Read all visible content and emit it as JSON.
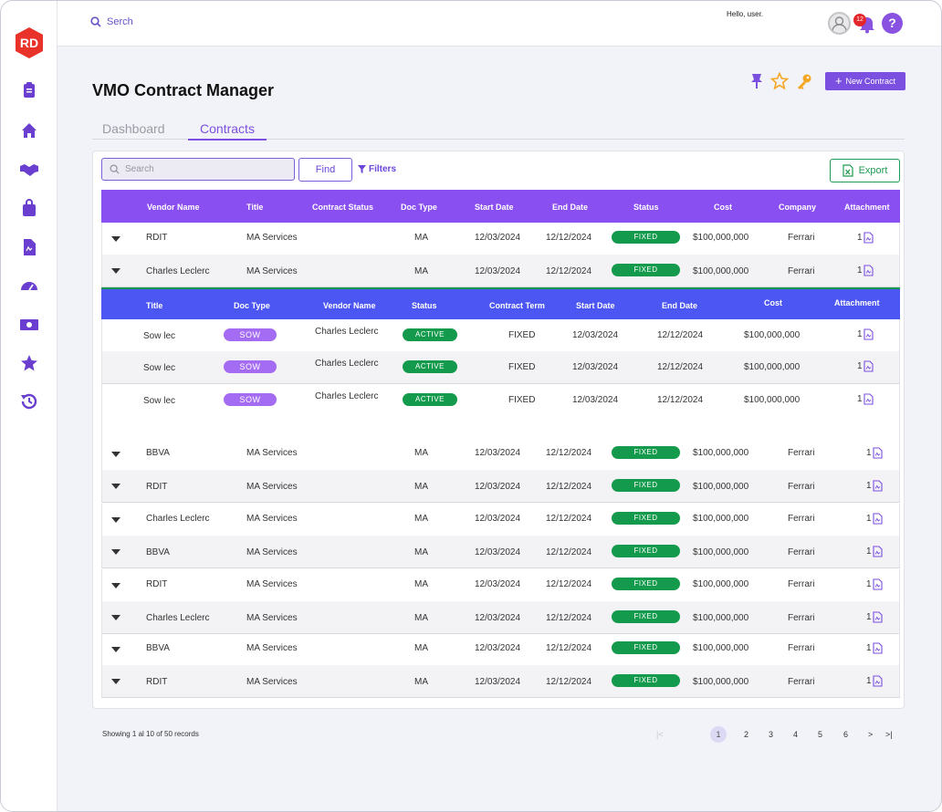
{
  "topbar": {
    "search_label": "Serch",
    "greeting": "Hello, user.",
    "notif_count": "12",
    "help_label": "?"
  },
  "page": {
    "title": "VMO Contract Manager",
    "new_contract_label": "New Contract"
  },
  "tabs": [
    {
      "label": "Dashboard"
    },
    {
      "label": "Contracts"
    }
  ],
  "toolbar": {
    "search_placeholder": "Search",
    "find_label": "Find",
    "filters_label": "Filters",
    "export_label": "Export"
  },
  "columns": [
    "Vendor Name",
    "Title",
    "Contract Status",
    "Doc Type",
    "Start Date",
    "End Date",
    "Status",
    "Cost",
    "Company",
    "Attachment"
  ],
  "sub_columns": [
    "Title",
    "Doc Type",
    "Vendor Name",
    "Status",
    "Contract Term",
    "Start Date",
    "End Date",
    "Cost",
    "Attachment"
  ],
  "rows": [
    {
      "vendor": "RDIT",
      "title": "MA Services",
      "doc": "MA",
      "start": "12/03/2024",
      "end": "12/12/2024",
      "status": "FIXED",
      "cost": "$100,000,000",
      "company": "Ferrari",
      "att": "1"
    },
    {
      "vendor": "Charles Leclerc",
      "title": "MA Services",
      "doc": "MA",
      "start": "12/03/2024",
      "end": "12/12/2024",
      "status": "FIXED",
      "cost": "$100,000,000",
      "company": "Ferrari",
      "att": "1"
    },
    {
      "vendor": "BBVA",
      "title": "MA Services",
      "doc": "MA",
      "start": "12/03/2024",
      "end": "12/12/2024",
      "status": "FIXED",
      "cost": "$100,000,000",
      "company": "Ferrari",
      "att": "1"
    },
    {
      "vendor": "RDIT",
      "title": "MA Services",
      "doc": "MA",
      "start": "12/03/2024",
      "end": "12/12/2024",
      "status": "FIXED",
      "cost": "$100,000,000",
      "company": "Ferrari",
      "att": "1"
    },
    {
      "vendor": "Charles Leclerc",
      "title": "MA Services",
      "doc": "MA",
      "start": "12/03/2024",
      "end": "12/12/2024",
      "status": "FIXED",
      "cost": "$100,000,000",
      "company": "Ferrari",
      "att": "1"
    },
    {
      "vendor": "BBVA",
      "title": "MA Services",
      "doc": "MA",
      "start": "12/03/2024",
      "end": "12/12/2024",
      "status": "FIXED",
      "cost": "$100,000,000",
      "company": "Ferrari",
      "att": "1"
    },
    {
      "vendor": "RDIT",
      "title": "MA Services",
      "doc": "MA",
      "start": "12/03/2024",
      "end": "12/12/2024",
      "status": "FIXED",
      "cost": "$100,000,000",
      "company": "Ferrari",
      "att": "1"
    },
    {
      "vendor": "Charles Leclerc",
      "title": "MA Services",
      "doc": "MA",
      "start": "12/03/2024",
      "end": "12/12/2024",
      "status": "FIXED",
      "cost": "$100,000,000",
      "company": "Ferrari",
      "att": "1"
    },
    {
      "vendor": "BBVA",
      "title": "MA Services",
      "doc": "MA",
      "start": "12/03/2024",
      "end": "12/12/2024",
      "status": "FIXED",
      "cost": "$100,000,000",
      "company": "Ferrari",
      "att": "1"
    },
    {
      "vendor": "RDIT",
      "title": "MA Services",
      "doc": "MA",
      "start": "12/03/2024",
      "end": "12/12/2024",
      "status": "FIXED",
      "cost": "$100,000,000",
      "company": "Ferrari",
      "att": "1"
    }
  ],
  "sub_rows": [
    {
      "title": "Sow lec",
      "doc": "SOW",
      "vendor": "Charles Leclerc",
      "status": "ACTIVE",
      "term": "FIXED",
      "start": "12/03/2024",
      "end": "12/12/2024",
      "cost": "$100,000,000",
      "att": "1"
    },
    {
      "title": "Sow lec",
      "doc": "SOW",
      "vendor": "Charles Leclerc",
      "status": "ACTIVE",
      "term": "FIXED",
      "start": "12/03/2024",
      "end": "12/12/2024",
      "cost": "$100,000,000",
      "att": "1"
    },
    {
      "title": "Sow lec",
      "doc": "SOW",
      "vendor": "Charles Leclerc",
      "status": "ACTIVE",
      "term": "FIXED",
      "start": "12/03/2024",
      "end": "12/12/2024",
      "cost": "$100,000,000",
      "att": "1"
    }
  ],
  "pagination": {
    "showing": "Showing 1 al 10 of 50 records",
    "first": "|<",
    "pages": [
      "1",
      "2",
      "3",
      "4",
      "5",
      "6"
    ],
    "next": ">",
    "last": ">|"
  },
  "colors": {
    "accent": "#7b4fe0",
    "header": "#8a4ff0",
    "sub_header": "#4c56f2",
    "status_green": "#149a4c",
    "sow": "#a46cf2"
  }
}
